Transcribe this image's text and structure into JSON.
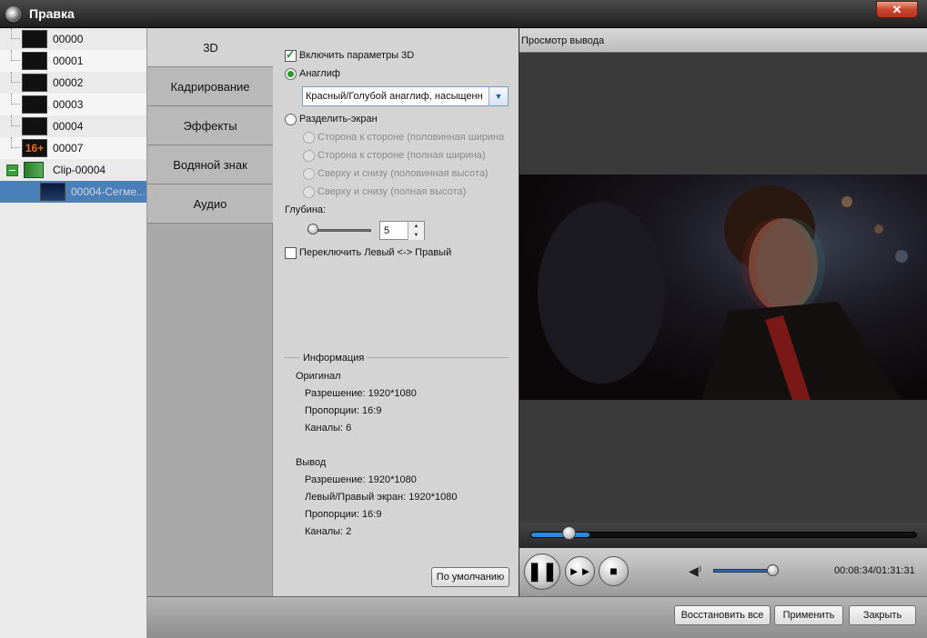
{
  "window": {
    "title": "Правка",
    "close_label": "✕"
  },
  "tree": {
    "items": [
      {
        "label": "00000"
      },
      {
        "label": "00001"
      },
      {
        "label": "00002"
      },
      {
        "label": "00003"
      },
      {
        "label": "00004"
      },
      {
        "label": "00007",
        "thumb_text": "16+"
      }
    ],
    "clip": {
      "label": "Clip-00004"
    },
    "segment": {
      "label": "00004-Сегме..."
    }
  },
  "tabs": [
    {
      "label": "3D"
    },
    {
      "label": "Кадрирование"
    },
    {
      "label": "Эффекты"
    },
    {
      "label": "Водяной знак"
    },
    {
      "label": "Аудио"
    }
  ],
  "settings3d": {
    "enable_label": "Включить параметры 3D",
    "enable_checked": true,
    "anaglyph_label": "Анаглиф",
    "anaglyph_value": "Красный/Голубой анаглиф, насыщенн",
    "split_label": "Разделить-экран",
    "split_options": [
      "Сторона к стороне (половинная ширина",
      "Сторона к стороне (полная ширина)",
      "Сверху и снизу (половинная высота)",
      "Сверху и снизу (полная высота)"
    ],
    "depth_label": "Глубина:",
    "depth_value": "5",
    "swap_label": "Переключить Левый <-> Правый",
    "swap_checked": false
  },
  "info": {
    "legend": "Информация",
    "original_title": "Оригинал",
    "original_lines": [
      "Разрешение: 1920*1080",
      "Пропорции: 16:9",
      "Каналы: 6"
    ],
    "output_title": "Вывод",
    "output_lines": [
      "Разрешение: 1920*1080",
      "Левый/Правый экран: 1920*1080",
      "Пропорции: 16:9",
      "Каналы: 2"
    ]
  },
  "default_button": "По умолчанию",
  "preview": {
    "title": "Просмотр вывода",
    "time": "00:08:34/01:31:31",
    "seek_progress": 0.094,
    "volume_level": 0.9
  },
  "bottom_buttons": {
    "restore_all": "Восстановить все",
    "apply": "Применить",
    "close": "Закрыть"
  },
  "colors": {
    "accent_blue": "#2a8ae0",
    "close_red": "#c9452c",
    "selection": "#4a7fb8"
  }
}
